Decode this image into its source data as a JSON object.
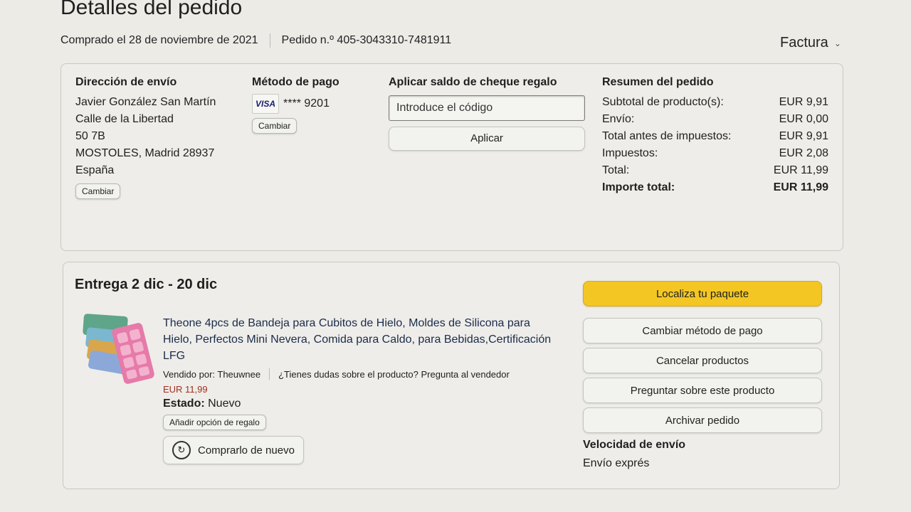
{
  "header": {
    "title": "Detalles del pedido",
    "purchased": "Comprado el 28 de noviembre de 2021",
    "order_number": "Pedido n.º 405-3043310-7481911",
    "invoice_label": "Factura"
  },
  "shipping": {
    "heading": "Dirección de envío",
    "lines": [
      "Javier González San Martín",
      "Calle de la Libertad",
      "50 7B",
      "MOSTOLES, Madrid 28937",
      "España"
    ],
    "change_label": "Cambiar"
  },
  "payment": {
    "heading": "Método de pago",
    "card_brand": "VISA",
    "card_number": "**** 9201",
    "change_label": "Cambiar"
  },
  "gift": {
    "heading": "Aplicar saldo de cheque regalo",
    "placeholder": "Introduce el código",
    "apply_label": "Aplicar"
  },
  "summary": {
    "heading": "Resumen del pedido",
    "rows": [
      {
        "label": "Subtotal de producto(s):",
        "value": "EUR 9,91"
      },
      {
        "label": "Envío:",
        "value": "EUR 0,00"
      },
      {
        "label": "Total antes de impuestos:",
        "value": "EUR 9,91"
      },
      {
        "label": "Impuestos:",
        "value": "EUR 2,08"
      },
      {
        "label": "Total:",
        "value": "EUR 11,99"
      }
    ],
    "grand_total_label": "Importe total:",
    "grand_total_value": "EUR 11,99"
  },
  "delivery": {
    "title": "Entrega 2 dic - 20 dic",
    "product_title": "Theone 4pcs de Bandeja para Cubitos de Hielo, Moldes de Silicona para Hielo, Perfectos Mini Nevera, Comida para Caldo, para Bebidas,Certificación LFG",
    "sold_by": "Vendido por: Theuwnee",
    "question": "¿Tienes dudas sobre el producto? Pregunta al vendedor",
    "price": "EUR 11,99",
    "state_label": "Estado:",
    "state_value": "Nuevo",
    "gift_option_label": "Añadir opción de regalo",
    "buy_again_label": "Comprarlo de nuevo"
  },
  "actions": {
    "track": "Localiza tu paquete",
    "change_payment": "Cambiar método de pago",
    "cancel": "Cancelar productos",
    "ask": "Preguntar sobre este producto",
    "archive": "Archivar pedido",
    "speed_label": "Velocidad de envío",
    "speed_value": "Envío exprés"
  },
  "colors": {
    "primary_button": "#f3c623",
    "price": "#a0301c",
    "background": "#ecebe6"
  },
  "icons": {
    "invoice_chevron": "chevron-down-icon",
    "buy_again": "refresh-bag-icon"
  }
}
